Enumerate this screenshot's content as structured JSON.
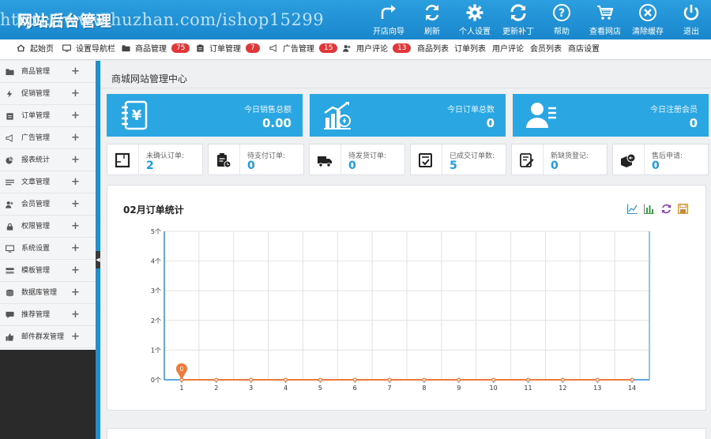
{
  "header": {
    "logo": "网站后台管理",
    "watermark": "https://www.huzhan.com/ishop15299",
    "tools": [
      {
        "label": "开店向导",
        "icon": "share-arrow-icon"
      },
      {
        "label": "刷新",
        "icon": "refresh-icon"
      },
      {
        "label": "个人设置",
        "icon": "gear-icon"
      },
      {
        "label": "更新补丁",
        "icon": "sync-icon"
      },
      {
        "label": "帮助",
        "icon": "help-icon"
      },
      {
        "label": "查看网店",
        "icon": "cart-icon"
      },
      {
        "label": "清除缓存",
        "icon": "clear-icon"
      },
      {
        "label": "退出",
        "icon": "power-icon"
      }
    ]
  },
  "nav": {
    "items": [
      {
        "label": "起始页",
        "icon": "home-icon",
        "badge": ""
      },
      {
        "label": "设置导航栏",
        "icon": "monitor-icon",
        "badge": ""
      },
      {
        "label": "商品管理",
        "icon": "folder-icon",
        "badge": "75"
      },
      {
        "label": "订单管理",
        "icon": "clipboard-icon",
        "badge": "7"
      },
      {
        "label": "广告管理",
        "icon": "megaphone-icon",
        "badge": "15"
      },
      {
        "label": "用户评论",
        "icon": "users-icon",
        "badge": "13"
      },
      {
        "label": "商品列表",
        "icon": "",
        "badge": ""
      },
      {
        "label": "订单列表",
        "icon": "",
        "badge": ""
      },
      {
        "label": "用户评论",
        "icon": "",
        "badge": ""
      },
      {
        "label": "会员列表",
        "icon": "",
        "badge": ""
      },
      {
        "label": "商店设置",
        "icon": "",
        "badge": ""
      }
    ]
  },
  "sidebar": {
    "items": [
      {
        "label": "商品管理",
        "icon": "folder-icon"
      },
      {
        "label": "促销管理",
        "icon": "bolt-icon"
      },
      {
        "label": "订单管理",
        "icon": "clipboard-icon"
      },
      {
        "label": "广告管理",
        "icon": "megaphone-icon"
      },
      {
        "label": "报表统计",
        "icon": "pie-chart-icon"
      },
      {
        "label": "文章管理",
        "icon": "list-icon"
      },
      {
        "label": "会员管理",
        "icon": "users-icon"
      },
      {
        "label": "权限管理",
        "icon": "lock-icon"
      },
      {
        "label": "系统设置",
        "icon": "monitor-icon"
      },
      {
        "label": "模板管理",
        "icon": "template-icon"
      },
      {
        "label": "数据库管理",
        "icon": "database-icon"
      },
      {
        "label": "推荐管理",
        "icon": "comment-icon"
      },
      {
        "label": "邮件群发管理",
        "icon": "thumbs-up-icon"
      }
    ],
    "plus": "+",
    "collapse": "◀"
  },
  "main": {
    "title": "商城网站管理中心",
    "stats": [
      {
        "label": "今日销售总额",
        "value": "0.00",
        "icon": "money-notebook-icon"
      },
      {
        "label": "今日订单总数",
        "value": "0",
        "icon": "growth-chart-icon"
      },
      {
        "label": "今日注册会员",
        "value": "0",
        "icon": "member-card-icon"
      }
    ],
    "minis": [
      {
        "label": "未确认订单:",
        "value": "2",
        "icon": "square-icon"
      },
      {
        "label": "待支付订单:",
        "value": "0",
        "icon": "payment-clipboard-icon"
      },
      {
        "label": "待发货订单:",
        "value": "0",
        "icon": "truck-icon"
      },
      {
        "label": "已成交订单数:",
        "value": "5",
        "icon": "check-doc-icon"
      },
      {
        "label": "新缺货登记:",
        "value": "0",
        "icon": "edit-doc-icon"
      },
      {
        "label": "售后申请:",
        "value": "0",
        "icon": "return-box-icon"
      }
    ]
  },
  "chart_data": {
    "type": "line",
    "title": "02月订单统计",
    "x": [
      "1",
      "2",
      "3",
      "4",
      "5",
      "6",
      "7",
      "8",
      "9",
      "10",
      "11",
      "12",
      "13",
      "14"
    ],
    "series": [
      {
        "values": [
          0,
          0,
          0,
          0,
          0,
          0,
          0,
          0,
          0,
          0,
          0,
          0,
          0,
          0
        ],
        "color": "#f07a3a"
      }
    ],
    "yticks": [
      "0个",
      "1个",
      "2个",
      "3个",
      "4个",
      "5个"
    ],
    "ylim": [
      0,
      5
    ],
    "markpoint": {
      "x": "1",
      "value": "0"
    },
    "grid": true,
    "axis_color": "#2a8fd6",
    "tools": [
      "line-chart-icon",
      "bar-chart-icon",
      "restore-icon",
      "save-icon"
    ]
  },
  "colors": {
    "accent": "#2aa6e3",
    "badge": "#e0383a",
    "value": "#1e9be0"
  }
}
